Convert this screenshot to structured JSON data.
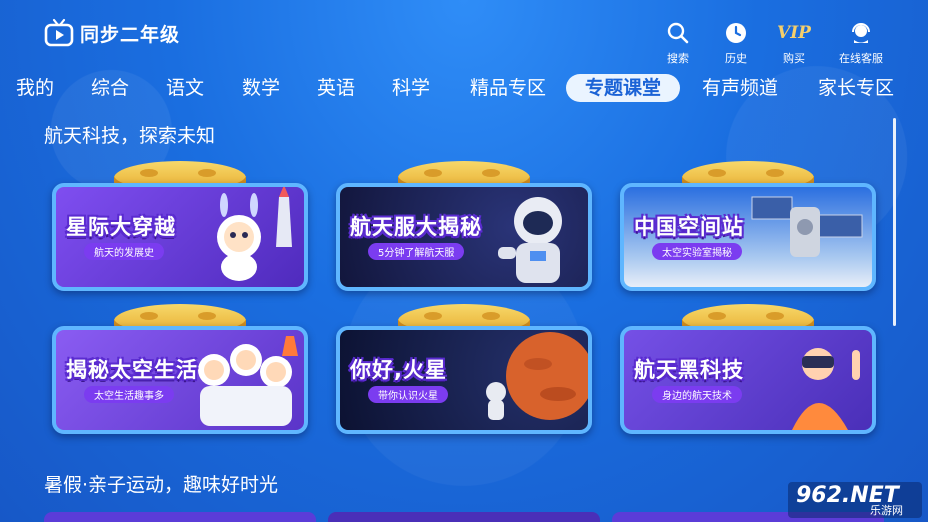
{
  "app": {
    "title": "同步二年级"
  },
  "header_actions": [
    {
      "label": "搜索",
      "icon": "search-icon"
    },
    {
      "label": "历史",
      "icon": "clock-icon"
    },
    {
      "label": "购买",
      "icon": "vip-icon",
      "badge": "VIP"
    },
    {
      "label": "在线客服",
      "icon": "headset-icon"
    }
  ],
  "tabs": [
    {
      "label": "我的"
    },
    {
      "label": "综合"
    },
    {
      "label": "语文"
    },
    {
      "label": "数学"
    },
    {
      "label": "英语"
    },
    {
      "label": "科学"
    },
    {
      "label": "精品专区"
    },
    {
      "label": "专题课堂",
      "active": true
    },
    {
      "label": "有声频道"
    },
    {
      "label": "家长专区"
    }
  ],
  "sections": [
    {
      "title": "航天科技，探索未知",
      "cards": [
        {
          "title": "星际大穿越",
          "subtitle": "航天的发展史",
          "bg": "#6a3fd8"
        },
        {
          "title": "航天服大揭秘",
          "subtitle": "5分钟了解航天服",
          "bg": "#1a1f4f"
        },
        {
          "title": "中国空间站",
          "subtitle": "太空实验室揭秘",
          "bg": "#2a6fd6"
        },
        {
          "title": "揭秘太空生活",
          "subtitle": "太空生活趣事多",
          "bg": "#7a4de0"
        },
        {
          "title": "你好,火星",
          "subtitle": "带你认识火星",
          "bg": "#0f1638"
        },
        {
          "title": "航天黑科技",
          "subtitle": "身边的航天技术",
          "bg": "#6a45d8"
        }
      ]
    },
    {
      "title": "暑假·亲子运动，趣味好时光"
    }
  ],
  "watermark": {
    "text": "962.NET",
    "sub": "乐游网"
  },
  "colors": {
    "accent": "#1b63d6",
    "active_tab_bg": "#eaf4ff",
    "card_border": "#5fb6ff",
    "vip_gold": "#f5cf6b"
  }
}
